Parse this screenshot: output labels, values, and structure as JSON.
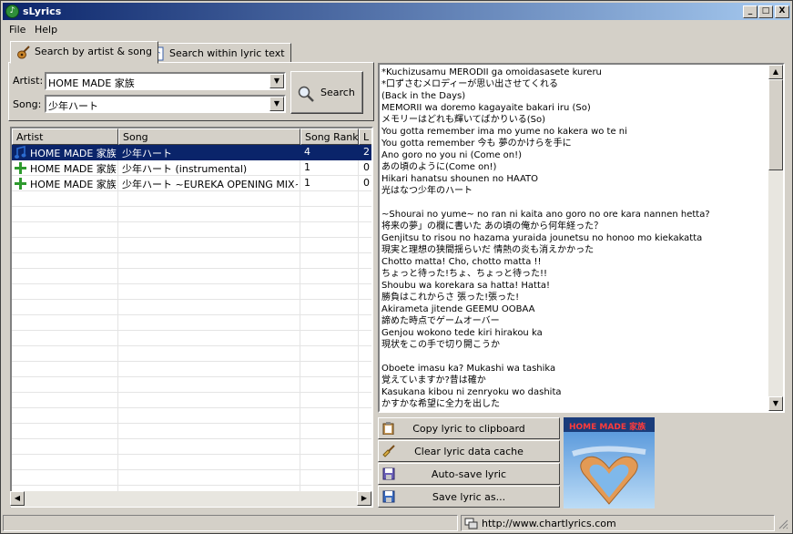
{
  "window": {
    "title": "sLyrics",
    "minimize": "_",
    "maximize": "□",
    "close": "X"
  },
  "menu": [
    "File",
    "Help"
  ],
  "tabs": [
    "Search by artist & song",
    "Search within lyric text"
  ],
  "search": {
    "artist_label": "Artist:",
    "artist_value": "HOME MADE 家族",
    "song_label": "Song:",
    "song_value": "少年ハート",
    "button_label": "Search"
  },
  "results": {
    "columns": [
      "Artist",
      "Song",
      "Song Rank",
      "L"
    ],
    "rows": [
      {
        "icon": "music-note-icon",
        "artist": "HOME MADE 家族",
        "song": "少年ハート",
        "rank": "4",
        "l": "2"
      },
      {
        "icon": "plus-icon",
        "artist": "HOME MADE 家族",
        "song": "少年ハート (instrumental)",
        "rank": "1",
        "l": "0"
      },
      {
        "icon": "plus-icon",
        "artist": "HOME MADE 家族",
        "song": "少年ハート ~EUREKA OPENING MIX~",
        "rank": "1",
        "l": "0"
      }
    ]
  },
  "lyrics": [
    "*Kuchizusamu MERODII ga omoidasasete kureru",
    "*口ずさむメロディーが思い出させてくれる",
    "(Back in the Days)",
    "MEMORII wa doremo kagayaite bakari iru (So)",
    "メモリーはどれも輝いてばかりいる(So)",
    "You gotta remember ima mo yume no kakera wo te ni",
    "You gotta remember 今も 夢のかけらを手に",
    "Ano goro no you ni (Come on!)",
    "あの頃のように(Come on!)",
    "Hikari hanatsu shounen no HAATO",
    "光はなつ少年のハート",
    "",
    "~Shourai no yume~ no ran ni kaita ano goro no ore kara nannen hetta?",
    "将来の夢」の欄に書いた あの頃の俺から何年経った？",
    "Genjitsu to risou no hazama yuraida jounetsu no honoo mo kiekakatta",
    "現実と理想の狭間揺らいだ 情熱の炎も消えかかった",
    "Chotto matta! Cho, chotto matta !!",
    "ちょっと待った!ちょ、ちょっと待った!!",
    "Shoubu wa korekara sa hatta! Hatta!",
    "勝負はこれからさ 張った!張った!",
    "Akirameta jitende GEEMU OOBAA",
    "諦めた時点でゲームオーバー",
    "Genjou wokono tede kiri hirakou ka",
    "現状をこの手で切り開こうか",
    "",
    "Oboete imasu ka? Mukashi wa tashika",
    "覚えていますか?昔は確か",
    "Kasukana kibou ni zenryoku wo dashita",
    "かすかな希望に全力を出した"
  ],
  "actions": {
    "copy": "Copy lyric to clipboard",
    "clear": "Clear lyric data cache",
    "autosave": "Auto-save lyric",
    "saveas": "Save lyric as..."
  },
  "album": {
    "text": "HOME MADE 家族"
  },
  "status": {
    "url": "http://www.chartlyrics.com"
  },
  "colors": {
    "title_start": "#0a246a",
    "title_end": "#a6caf0",
    "selection": "#0a246a",
    "face": "#d4d0c8"
  }
}
